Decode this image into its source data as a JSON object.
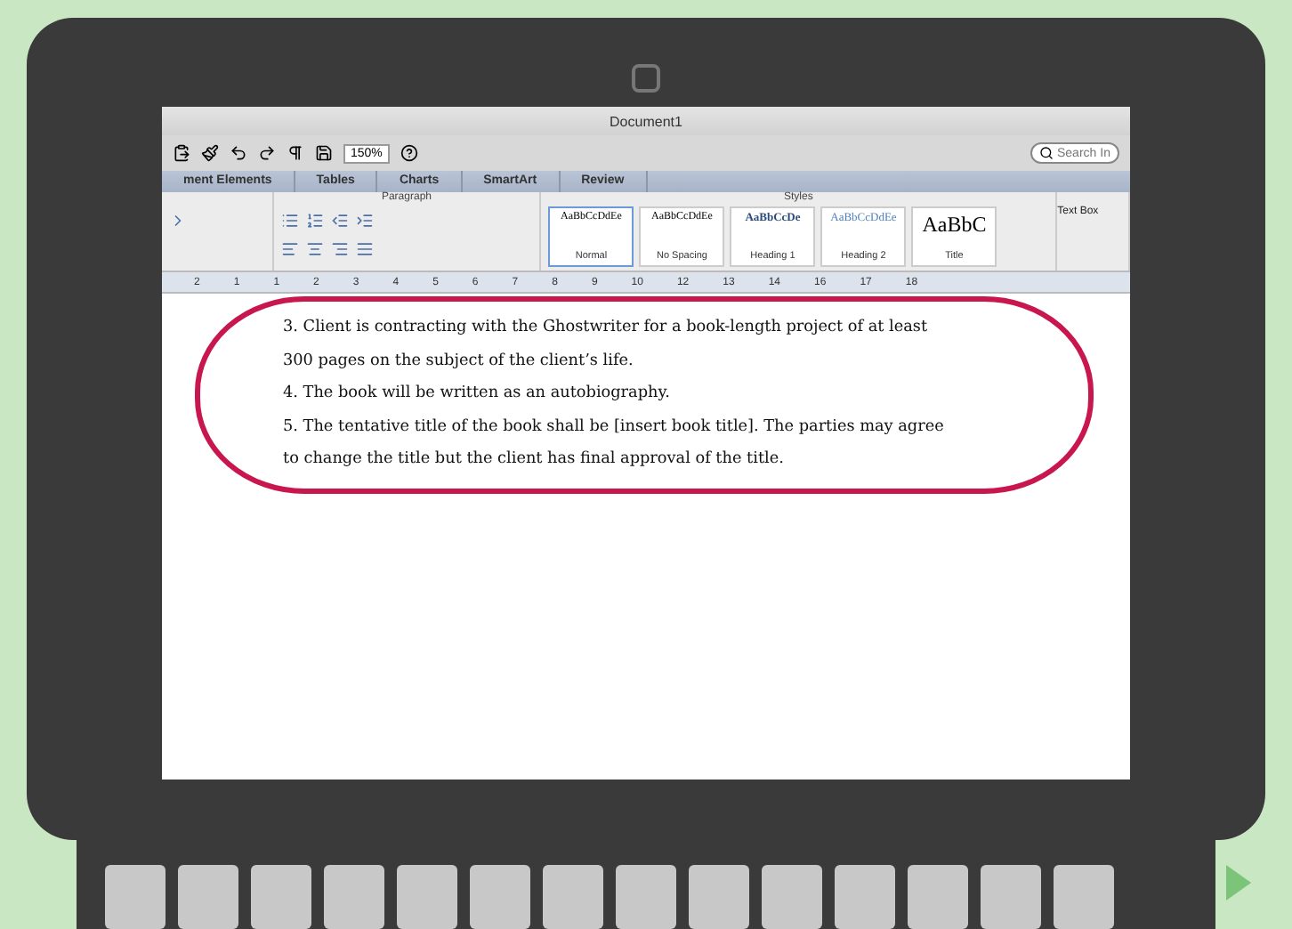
{
  "window": {
    "title": "Document1"
  },
  "toolbar": {
    "zoom": "150%",
    "search": {
      "placeholder": "Search In"
    }
  },
  "tabs": [
    {
      "label": "ment Elements",
      "selected": false
    },
    {
      "label": "Tables",
      "selected": false
    },
    {
      "label": "Charts",
      "selected": false
    },
    {
      "label": "SmartArt",
      "selected": false
    },
    {
      "label": "Review",
      "selected": false
    }
  ],
  "groups": [
    "Paragraph",
    "Styles"
  ],
  "styles": [
    {
      "preview": "AaBbCcDdEe",
      "name": "Normal",
      "kind": "normal",
      "selected": true
    },
    {
      "preview": "AaBbCcDdEe",
      "name": "No Spacing",
      "kind": "normal",
      "selected": false
    },
    {
      "preview": "AaBbCcDe",
      "name": "Heading 1",
      "kind": "h1",
      "selected": false
    },
    {
      "preview": "AaBbCcDdEe",
      "name": "Heading 2",
      "kind": "h2",
      "selected": false
    },
    {
      "preview": "AaBbC",
      "name": "Title",
      "kind": "title",
      "selected": false
    }
  ],
  "text_box": "Text Box",
  "ruler": [
    "2",
    "1",
    "1",
    "2",
    "3",
    "4",
    "5",
    "6",
    "7",
    "8",
    "9",
    "10",
    "12",
    "13",
    "14",
    "16",
    "17",
    "18"
  ],
  "document": {
    "paragraphs": [
      "3. Client is contracting with the Ghostwriter for a book-length project of at least 300 pages on the subject of the client’s life.",
      "4. The book will be written as an autobiography.",
      "5. The tentative title of the book shall be [insert book title]. The parties may agree to change the title but the client has final approval of the title."
    ]
  }
}
